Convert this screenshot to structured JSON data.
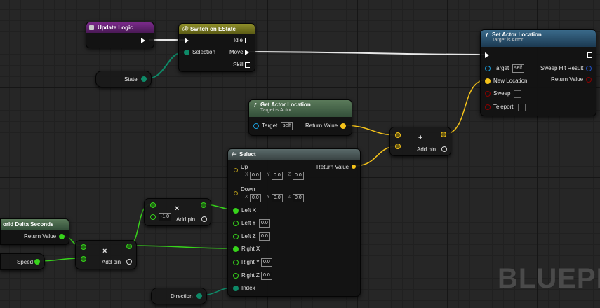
{
  "nodes": {
    "update_logic": {
      "title": "Update Logic"
    },
    "switch": {
      "title": "Switch on EState",
      "pins_in": {
        "selection": "Selection"
      },
      "pins_out": [
        "Idle",
        "Move",
        "Skill"
      ]
    },
    "state_var": {
      "label": "State"
    },
    "set_actor_location": {
      "title": "Set Actor Location",
      "subtitle": "Target is Actor",
      "target": "Target",
      "target_value": "self",
      "new_location": "New Location",
      "sweep": "Sweep",
      "teleport": "Teleport",
      "sweep_hit_result": "Sweep Hit Result",
      "return_value": "Return Value"
    },
    "get_actor_location": {
      "title": "Get Actor Location",
      "subtitle": "Target is Actor",
      "target": "Target",
      "target_value": "self",
      "return_value": "Return Value"
    },
    "add_vector": {
      "symbol": "+",
      "add_pin": "Add pin"
    },
    "select": {
      "title": "Select",
      "return_value": "Return Value",
      "up": "Up",
      "down": "Down",
      "up_xyz": [
        "0.0",
        "0.0",
        "0.0"
      ],
      "down_xyz": [
        "0.0",
        "0.0",
        "0.0"
      ],
      "xyz_labels": [
        "X",
        "Y",
        "Z"
      ],
      "left_x": "Left X",
      "left_y": "Left Y",
      "left_z": "Left Z",
      "left_y_value": "0.0",
      "left_z_value": "0.0",
      "right_x": "Right X",
      "right_y": "Right Y",
      "right_z": "Right Z",
      "right_y_value": "0.0",
      "right_z_value": "0.0",
      "index": "Index"
    },
    "multiply_neg": {
      "symbol": "×",
      "value": "-1.0",
      "add_pin": "Add pin"
    },
    "world_delta": {
      "title": "orld Delta Seconds",
      "return_value": "Return Value"
    },
    "speed_var": {
      "label": "Speed"
    },
    "multiply_speed": {
      "symbol": "×",
      "add_pin": "Add pin"
    },
    "direction_var": {
      "label": "Direction"
    }
  },
  "watermark": "BLUEPR",
  "colors": {
    "exec": "#ffffff",
    "enum": "#0e8a68",
    "float": "#37d31b",
    "vector": "#f5c31a",
    "object": "#1a9bd8",
    "struct": "#1f4ebf",
    "bool": "#8b0000"
  }
}
